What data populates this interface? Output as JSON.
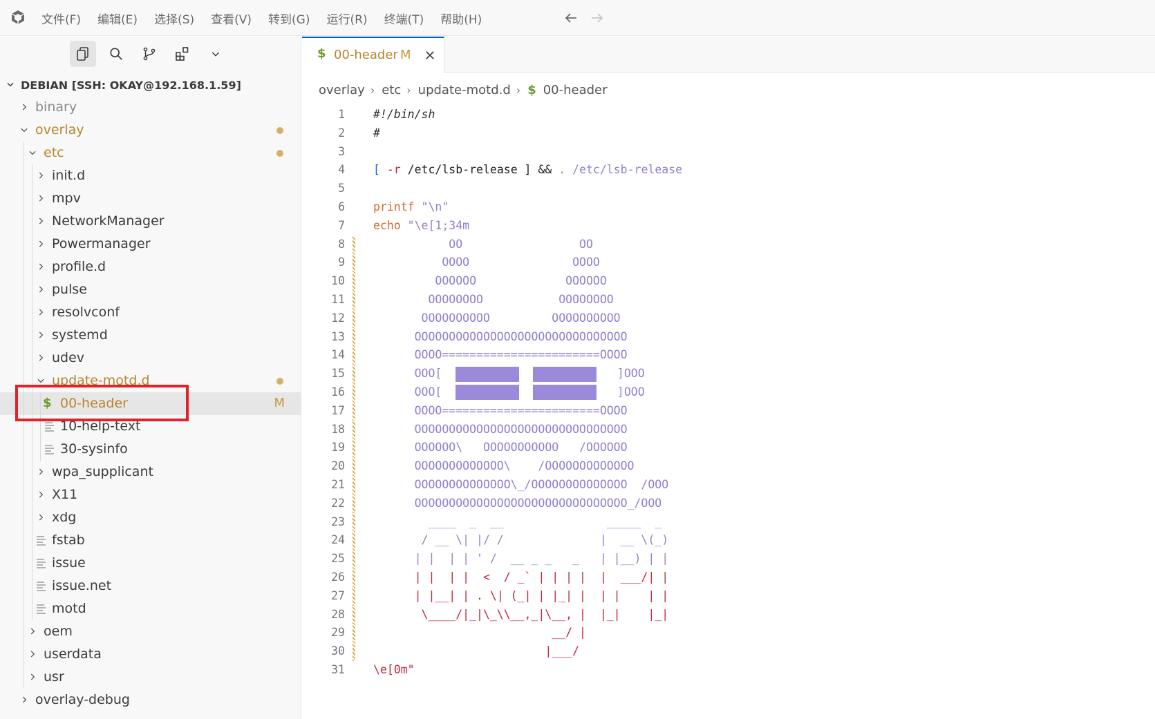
{
  "menu": [
    "文件(F)",
    "编辑(E)",
    "选择(S)",
    "查看(V)",
    "转到(G)",
    "运行(R)",
    "终端(T)",
    "帮助(H)"
  ],
  "explorer": {
    "title": "DEBIAN [SSH: OKAY@192.168.1.59]",
    "items": [
      {
        "label": "binary"
      },
      {
        "label": "overlay"
      },
      {
        "label": "etc"
      },
      {
        "label": "init.d"
      },
      {
        "label": "mpv"
      },
      {
        "label": "NetworkManager"
      },
      {
        "label": "Powermanager"
      },
      {
        "label": "profile.d"
      },
      {
        "label": "pulse"
      },
      {
        "label": "resolvconf"
      },
      {
        "label": "systemd"
      },
      {
        "label": "udev"
      },
      {
        "label": "update-motd.d"
      },
      {
        "label": "00-header",
        "badge": "M"
      },
      {
        "label": "10-help-text"
      },
      {
        "label": "30-sysinfo"
      },
      {
        "label": "wpa_supplicant"
      },
      {
        "label": "X11"
      },
      {
        "label": "xdg"
      },
      {
        "label": "fstab"
      },
      {
        "label": "issue"
      },
      {
        "label": "issue.net"
      },
      {
        "label": "motd"
      },
      {
        "label": "oem"
      },
      {
        "label": "userdata"
      },
      {
        "label": "usr"
      },
      {
        "label": "overlay-debug"
      }
    ]
  },
  "tab": {
    "name": "00-header",
    "status": "M",
    "icon": "$"
  },
  "breadcrumb": [
    "overlay",
    "etc",
    "update-motd.d",
    "00-header"
  ],
  "code": {
    "line_numbers": [
      "1",
      "2",
      "3",
      "4",
      "5",
      "6",
      "7",
      "8",
      "9",
      "10",
      "11",
      "12",
      "13",
      "14",
      "15",
      "16",
      "17",
      "18",
      "19",
      "20",
      "21",
      "22",
      "23",
      "24",
      "25",
      "26",
      "27",
      "28",
      "29",
      "30",
      "31"
    ],
    "l1": "#!/bin/sh",
    "l2": "#",
    "l4_a": "[ ",
    "l4_b": "-r",
    "l4_c": " /etc/lsb-release ] ",
    "l4_d": "&&",
    "l4_e": " . /etc/lsb-release",
    "l6_a": "printf",
    "l6_b": " \"\\n\"",
    "l7_a": "echo",
    "l7_b": " \"\\e[1;34m",
    "l8": "           OO                 OO",
    "l9": "          OOOO               OOOO",
    "l10": "         OOOOOO             OOOOOO",
    "l11": "        OOOOOOOO           OOOOOOOO",
    "l12": "       OOOOOOOOOO         OOOOOOOOOO",
    "l13": "      OOOOOOOOOOOOOOOOOOOOOOOOOOOOOOO",
    "l14": "      OOOO=======================OOOO",
    "l15_a": "      OOO[  ",
    "l15_b": "  ",
    "l15_c": "   ]OOO",
    "l16_a": "      OOO[  ",
    "l16_b": "  ",
    "l16_c": "   ]OOO",
    "l17": "      OOOO=======================OOOO",
    "l18": "      OOOOOOOOOOOOOOOOOOOOOOOOOOOOOOO",
    "l19": "      OOOOOO\\   OOOOOOOOOOO   /OOOOOO",
    "l20": "      OOOOOOOOOOOOO\\    /OOOOOOOOOOOOO",
    "l21": "      OOOOOOOOOOOOOO\\_/OOOOOOOOOOOOOO  /OOO",
    "l22": "      OOOOOOOOOOOOOOOOOOOOOOOOOOOOOOO_/OOO",
    "l23": "        ____  _  __               _____  _",
    "l24": "       / __ \\| |/ /              |  __ \\(_)",
    "l25": "      | |  | | ' /  __ _ _   _   | |__) | |",
    "l26": "      | |  | |  <  / _` | | | |  |  ___/| |",
    "l27": "      | |__| | . \\| (_| | |_| |  | |    | |",
    "l28": "       \\____/|_|\\_\\\\__,_|\\__, |  |_|    |_|",
    "l29": "                          __/ |",
    "l30": "                         |___/",
    "l31": "\\e[0m\""
  },
  "colors": {
    "accent": "#005fb8",
    "modified": "#b8852d",
    "highlight": "#e0232b"
  }
}
